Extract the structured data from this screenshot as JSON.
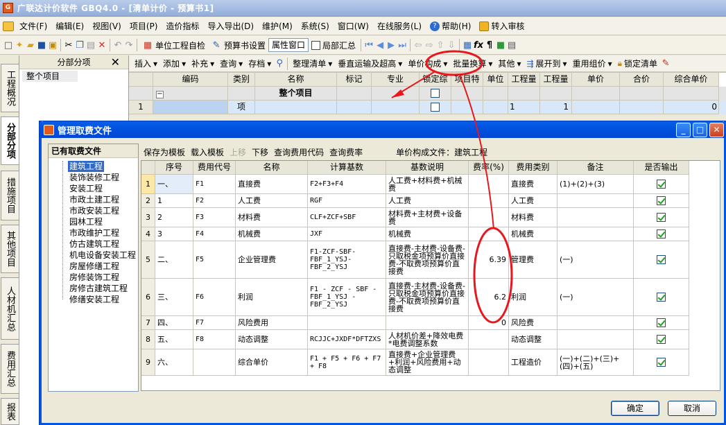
{
  "app": {
    "title": "广联达计价软件 GBQ4.0 - [清单计价 - 预算书1]",
    "icon_letter": "G"
  },
  "menu": [
    {
      "label": "文件(F)",
      "icon": "file-icon"
    },
    {
      "label": "编辑(E)"
    },
    {
      "label": "视图(V)"
    },
    {
      "label": "项目(P)"
    },
    {
      "label": "造价指标"
    },
    {
      "label": "导入导出(D)"
    },
    {
      "label": "维护(M)"
    },
    {
      "label": "系统(S)"
    },
    {
      "label": "窗口(W)"
    },
    {
      "label": "在线服务(L)"
    },
    {
      "label": "帮助(H)",
      "icon": "help-icon"
    },
    {
      "label": "转入审核",
      "icon": "transfer-audit-icon"
    }
  ],
  "toolbar1": {
    "self_check": "单位工程自检",
    "budget_settings": "预算书设置",
    "attr_window": "属性窗口",
    "partial_summary": "局部汇总"
  },
  "left_panel": {
    "title": "分部分项",
    "close": "✕",
    "root_item": "整个项目"
  },
  "vertical_tabs": [
    "工程概况",
    "分部分项",
    "措施项目",
    "其他项目",
    "人材机汇总",
    "费用汇总",
    "报表"
  ],
  "main_toolbar": [
    "插入",
    "添加",
    "补充",
    "查询",
    "存档",
    "整理清单",
    "垂直运输及超高",
    "单价构成",
    "批量换算",
    "其他",
    "展开到",
    "重用组价",
    "锁定清单"
  ],
  "grid": {
    "headers": [
      "",
      "编码",
      "类别",
      "名称",
      "标记",
      "专业",
      "锁定综",
      "项目特",
      "单位",
      "工程量",
      "工程量",
      "单价",
      "合价",
      "综合单价"
    ],
    "rows": [
      {
        "rownum": "",
        "code": "−",
        "type": "",
        "name": "整个项目",
        "qty_expr": "",
        "qty": "",
        "total": ""
      },
      {
        "rownum": "1",
        "code": "",
        "type": "项",
        "name": "",
        "qty_expr": "1",
        "qty": "1",
        "total": "0"
      }
    ]
  },
  "dialog": {
    "title": "管理取费文件",
    "left_title": "已有取费文件",
    "tree": [
      "建筑工程",
      "装饰装修工程",
      "安装工程",
      "市政土建工程",
      "市政安装工程",
      "园林工程",
      "市政维护工程",
      "仿古建筑工程",
      "机电设备安装工程",
      "房屋修缮工程",
      "房修装饰工程",
      "房修古建筑工程",
      "修缮安装工程"
    ],
    "selected_tree": "建筑工程",
    "toolbar": {
      "save_template": "保存为模板",
      "load_template": "载入模板",
      "move_up": "上移",
      "move_down": "下移",
      "query_code": "查询费用代码",
      "query_rate": "查询费率",
      "file_label": "单价构成文件：建筑工程"
    },
    "table_headers": [
      "",
      "序号",
      "费用代号",
      "名称",
      "计算基数",
      "基数说明",
      "费率(%)",
      "费用类别",
      "备注",
      "是否输出"
    ],
    "rows": [
      {
        "rn": "1",
        "seq": "一、",
        "code": "F1",
        "name": "直接费",
        "base": "F2+F3+F4",
        "desc": "人工费+材料费+机械费",
        "rate": "",
        "cat": "直接费",
        "note": "(1)+(2)+(3)",
        "out": true
      },
      {
        "rn": "2",
        "seq": "1",
        "code": "F2",
        "name": "人工费",
        "base": "RGF",
        "desc": "人工费",
        "rate": "",
        "cat": "人工费",
        "note": "",
        "out": true
      },
      {
        "rn": "3",
        "seq": "2",
        "code": "F3",
        "name": "材料费",
        "base": "CLF+ZCF+SBF",
        "desc": "材料费+主材费+设备费",
        "rate": "",
        "cat": "材料费",
        "note": "",
        "out": true
      },
      {
        "rn": "4",
        "seq": "3",
        "code": "F4",
        "name": "机械费",
        "base": "JXF",
        "desc": "机械费",
        "rate": "",
        "cat": "机械费",
        "note": "",
        "out": true
      },
      {
        "rn": "5",
        "seq": "二、",
        "code": "F5",
        "name": "企业管理费",
        "base": "F1-ZCF-SBF-FBF_1_YSJ-FBF_2_YSJ",
        "desc": "直接费-主材费-设备费-只取税金项预算价直接费-不取费项预算价直接费",
        "rate": "6.39",
        "cat": "管理费",
        "note": "(一)",
        "out": true
      },
      {
        "rn": "6",
        "seq": "三、",
        "code": "F6",
        "name": "利润",
        "base": "F1 - ZCF - SBF - FBF_1_YSJ - FBF_2_YSJ",
        "desc": "直接费-主材费-设备费-只取税金项预算价直接费-不取费项预算价直接费",
        "rate": "6.2",
        "cat": "利润",
        "note": "(一)",
        "out": true
      },
      {
        "rn": "7",
        "seq": "四、",
        "code": "F7",
        "name": "风险费用",
        "base": "",
        "desc": "",
        "rate": "0",
        "cat": "风险费",
        "note": "",
        "out": true
      },
      {
        "rn": "8",
        "seq": "五、",
        "code": "F8",
        "name": "动态调整",
        "base": "RCJJC+JXDF*DFTZXS",
        "desc": "人材机价差+降效电费*电费调整系数",
        "rate": "",
        "cat": "动态调整",
        "note": "",
        "out": true
      },
      {
        "rn": "9",
        "seq": "六、",
        "code": "",
        "name": "综合单价",
        "base": "F1 + F5 + F6 + F7 + F8",
        "desc": "直接费+企业管理费+利润+风险费用+动态调整",
        "rate": "",
        "cat": "工程造价",
        "note": "(一)+(二)+(三)+(四)+(五)",
        "out": true
      }
    ],
    "ok": "确定",
    "cancel": "取消"
  },
  "colors": {
    "accent": "#0054E3",
    "annotation": "#E8171E",
    "check": "#21A121"
  }
}
